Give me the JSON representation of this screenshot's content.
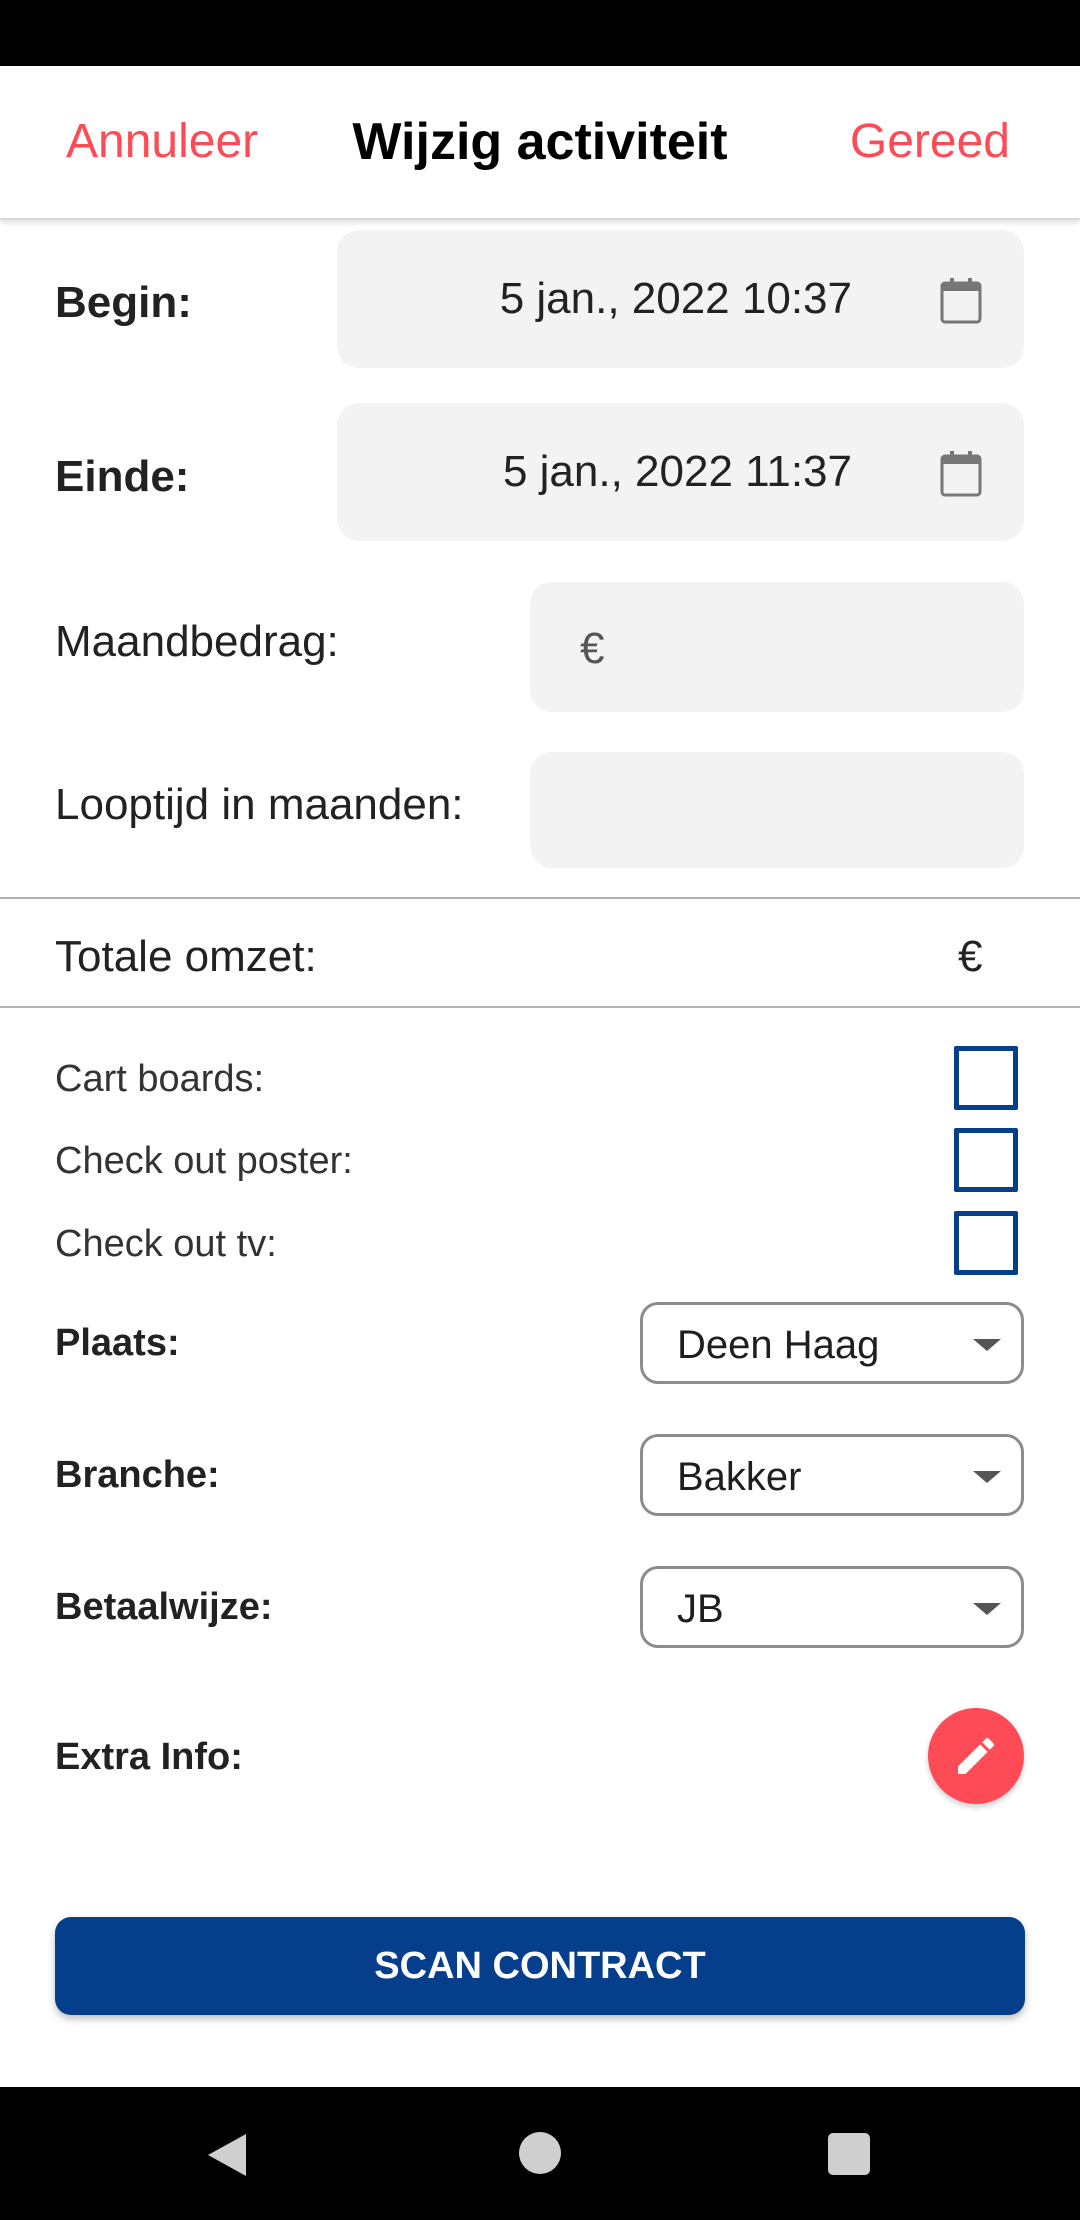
{
  "header": {
    "cancel_label": "Annuleer",
    "title": "Wijzig activiteit",
    "done_label": "Gereed"
  },
  "begin": {
    "label": "Begin:",
    "value": "5 jan., 2022 10:37"
  },
  "end": {
    "label": "Einde:",
    "value": "5 jan., 2022 11:37"
  },
  "monthly_amount": {
    "label": "Maandbedrag:",
    "prefix": "€",
    "value": ""
  },
  "duration": {
    "label": "Looptijd in maanden:",
    "value": ""
  },
  "total": {
    "label": "Totale omzet:",
    "value": "€"
  },
  "checkboxes": [
    {
      "label": "Cart boards:",
      "checked": false
    },
    {
      "label": "Check out poster:",
      "checked": false
    },
    {
      "label": "Check out tv:",
      "checked": false
    }
  ],
  "place": {
    "label": "Plaats:",
    "selected": "Deen Haag"
  },
  "branch": {
    "label": "Branche:",
    "selected": "Bakker"
  },
  "payment": {
    "label": "Betaalwijze:",
    "selected": "JB"
  },
  "extra_info": {
    "label": "Extra Info:"
  },
  "scan_button": {
    "label": "SCAN CONTRACT"
  },
  "colors": {
    "accent_red": "#ff4b55",
    "primary_blue": "#053f8c",
    "field_bg": "#f3f3f3"
  },
  "icons": {
    "date_picker": "calendar-icon",
    "extra_info": "pencil-icon",
    "nav_back": "back-triangle-icon",
    "nav_home": "home-circle-icon",
    "nav_recents": "recents-square-icon"
  }
}
